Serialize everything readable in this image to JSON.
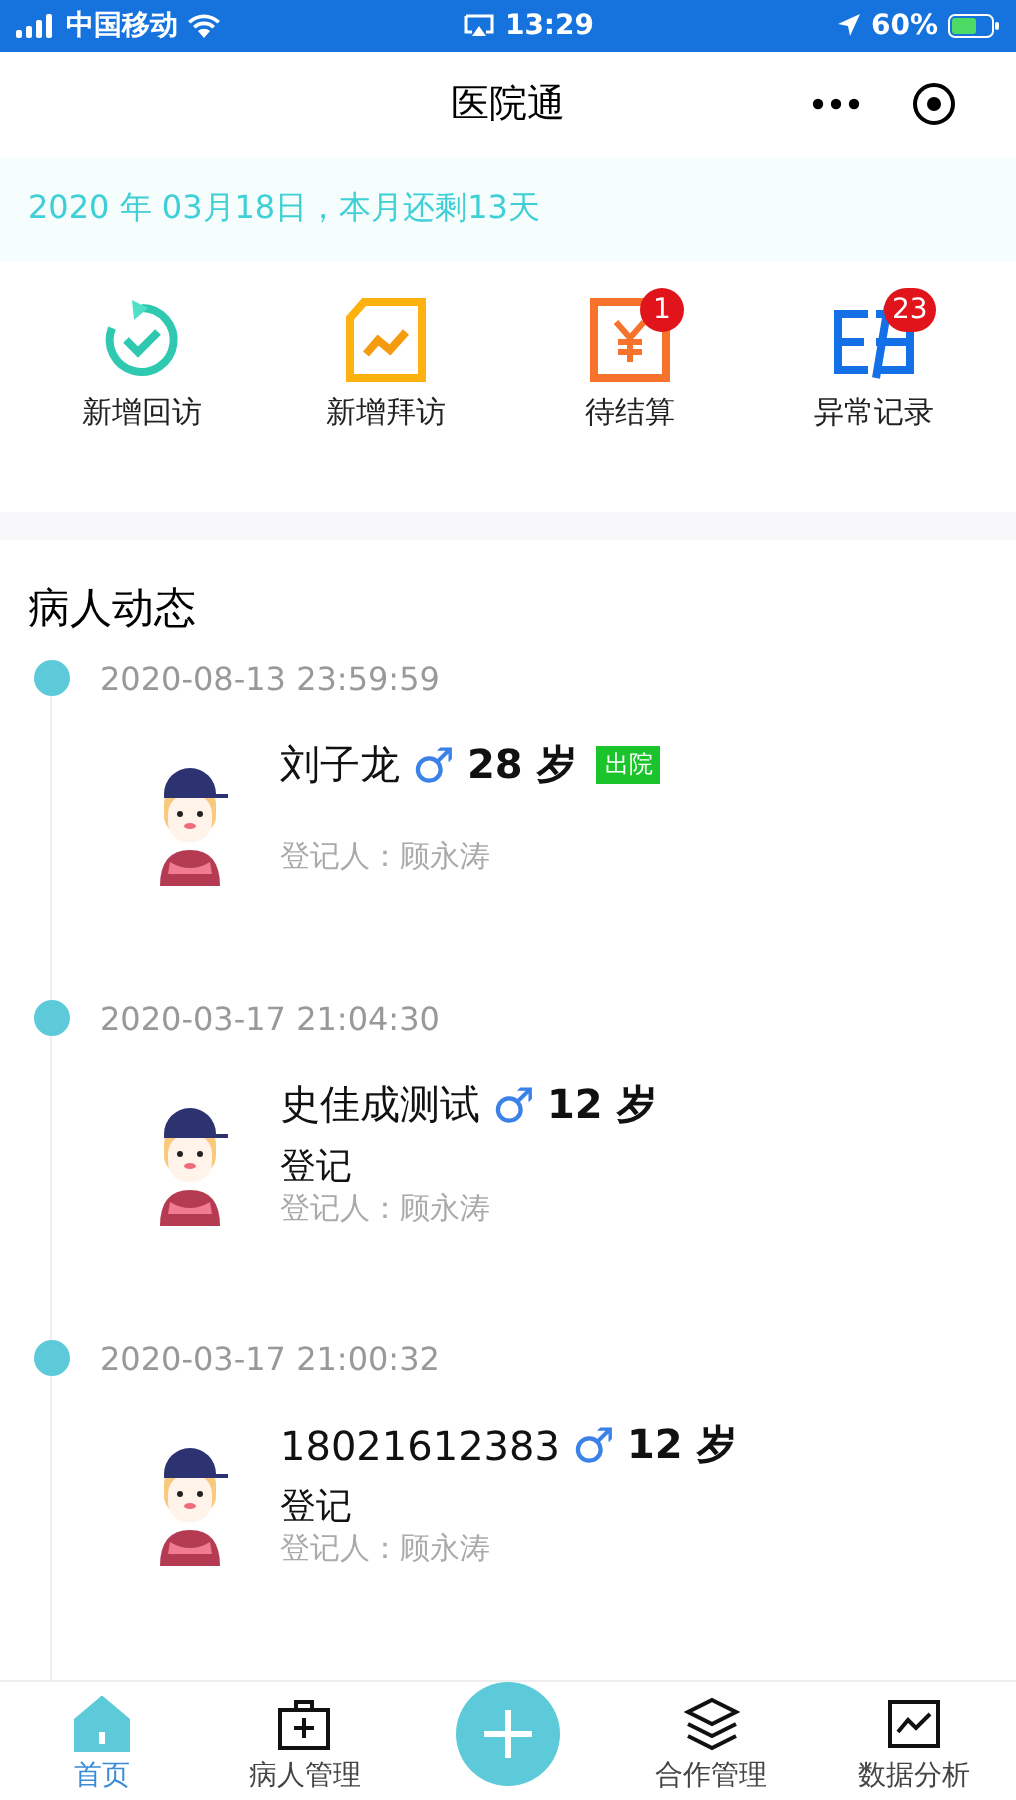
{
  "status_bar": {
    "carrier": "中国移动",
    "time": "13:29",
    "battery": "60%"
  },
  "nav": {
    "title": "医院通"
  },
  "banner": {
    "text": "2020 年 03月18日，本月还剩13天"
  },
  "shortcuts": [
    {
      "kind": "revisit",
      "label": "新增回访"
    },
    {
      "kind": "visit",
      "label": "新增拜访"
    },
    {
      "kind": "settle",
      "label": "待结算",
      "badge": "1"
    },
    {
      "kind": "abnormal",
      "label": "异常记录",
      "badge": "23"
    }
  ],
  "section": {
    "title": "病人动态"
  },
  "records": [
    {
      "time": "2020-08-13 23:59:59",
      "name": "刘子龙",
      "sex": "♂",
      "age": "28 岁",
      "tag": "出院",
      "registrar": "登记人：顾永涛"
    },
    {
      "time": "2020-03-17 21:04:30",
      "name": "史佳成测试",
      "sex": "♂",
      "age": "12 岁",
      "status": "登记",
      "registrar": "登记人：顾永涛"
    },
    {
      "time": "2020-03-17 21:00:32",
      "name": "18021612383",
      "sex": "♂",
      "age": "12 岁",
      "status": "登记",
      "registrar": "登记人：顾永涛"
    }
  ],
  "tabbar": [
    {
      "kind": "home",
      "label": "首页",
      "selected": true
    },
    {
      "kind": "patients",
      "label": "病人管理",
      "selected": false
    },
    {
      "kind": "add"
    },
    {
      "kind": "cooperation",
      "label": "合作管理",
      "selected": false
    },
    {
      "kind": "analysis",
      "label": "数据分析",
      "selected": false
    }
  ]
}
